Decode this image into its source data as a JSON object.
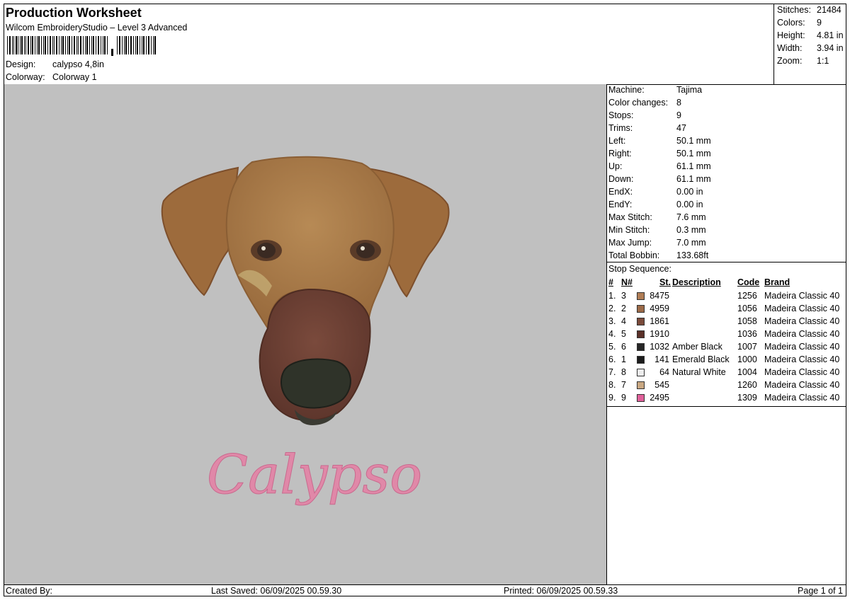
{
  "header": {
    "title": "Production Worksheet",
    "subtitle": "Wilcom EmbroideryStudio – Level 3 Advanced",
    "design_label": "Design:",
    "design_value": "calypso 4,8in",
    "colorway_label": "Colorway:",
    "colorway_value": "Colorway 1"
  },
  "summary": {
    "stitches_label": "Stitches:",
    "stitches": "21484",
    "colors_label": "Colors:",
    "colors": "9",
    "height_label": "Height:",
    "height": "4.81 in",
    "width_label": "Width:",
    "width": "3.94 in",
    "zoom_label": "Zoom:",
    "zoom": "1:1"
  },
  "preview": {
    "text": "Calypso",
    "text_color": "#e088a8",
    "background": "#c0c0c0"
  },
  "machine": [
    {
      "label": "Machine:",
      "value": "Tajima"
    },
    {
      "label": "Color changes:",
      "value": "8"
    },
    {
      "label": "Stops:",
      "value": "9"
    },
    {
      "label": "Trims:",
      "value": "47"
    },
    {
      "label": "Left:",
      "value": "50.1 mm"
    },
    {
      "label": "Right:",
      "value": "50.1 mm"
    },
    {
      "label": "Up:",
      "value": "61.1 mm"
    },
    {
      "label": "Down:",
      "value": "61.1 mm"
    },
    {
      "label": "EndX:",
      "value": "0.00 in"
    },
    {
      "label": "EndY:",
      "value": "0.00 in"
    },
    {
      "label": "Max Stitch:",
      "value": "7.6 mm"
    },
    {
      "label": "Min Stitch:",
      "value": "0.3 mm"
    },
    {
      "label": "Max Jump:",
      "value": "7.0 mm"
    },
    {
      "label": "Total Bobbin:",
      "value": "133.68ft"
    }
  ],
  "stop_sequence": {
    "title": "Stop Sequence:",
    "headers": {
      "num": "#",
      "n": "N#",
      "st": "St.",
      "description": "Description",
      "code": "Code",
      "brand": "Brand"
    },
    "rows": [
      {
        "num": "1.",
        "n": "3",
        "color": "#b07d55",
        "st": "8475",
        "description": "",
        "code": "1256",
        "brand": "Madeira Classic 40"
      },
      {
        "num": "2.",
        "n": "2",
        "color": "#9c6a48",
        "st": "4959",
        "description": "",
        "code": "1056",
        "brand": "Madeira Classic 40"
      },
      {
        "num": "3.",
        "n": "4",
        "color": "#7a4a3a",
        "st": "1861",
        "description": "",
        "code": "1058",
        "brand": "Madeira Classic 40"
      },
      {
        "num": "4.",
        "n": "5",
        "color": "#5a3028",
        "st": "1910",
        "description": "",
        "code": "1036",
        "brand": "Madeira Classic 40"
      },
      {
        "num": "5.",
        "n": "6",
        "color": "#262626",
        "st": "1032",
        "description": "Amber Black",
        "code": "1007",
        "brand": "Madeira Classic 40"
      },
      {
        "num": "6.",
        "n": "1",
        "color": "#1c1c1c",
        "st": "141",
        "description": "Emerald Black",
        "code": "1000",
        "brand": "Madeira Classic 40"
      },
      {
        "num": "7.",
        "n": "8",
        "color": "#ececec",
        "st": "64",
        "description": "Natural White",
        "code": "1004",
        "brand": "Madeira Classic 40"
      },
      {
        "num": "8.",
        "n": "7",
        "color": "#c9a882",
        "st": "545",
        "description": "",
        "code": "1260",
        "brand": "Madeira Classic 40"
      },
      {
        "num": "9.",
        "n": "9",
        "color": "#e0609a",
        "st": "2495",
        "description": "",
        "code": "1309",
        "brand": "Madeira Classic 40"
      }
    ]
  },
  "footer": {
    "created_by": "Created By:",
    "last_saved": "Last Saved: 06/09/2025 00.59.30",
    "printed": "Printed: 06/09/2025 00.59.33",
    "page": "Page 1 of 1"
  }
}
